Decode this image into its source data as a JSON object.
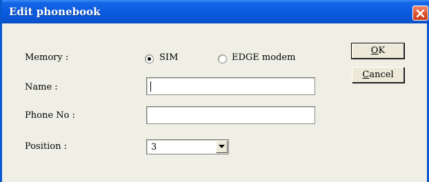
{
  "window": {
    "title": "Edit phonebook",
    "close_icon": "close-icon"
  },
  "colors": {
    "titlebar": "#0a5ce0",
    "client": "#efefe6",
    "close_button": "#d9532f"
  },
  "form": {
    "memory_label": "Memory :",
    "memory_options": [
      {
        "label": "SIM",
        "selected": true
      },
      {
        "label": "EDGE modem",
        "selected": false
      }
    ],
    "name_label": "Name :",
    "name_value": "",
    "phone_label": "Phone No :",
    "phone_value": "",
    "position_label": "Position :",
    "position_value": "3"
  },
  "buttons": {
    "ok_label": "OK",
    "cancel_label": "Cancel"
  }
}
